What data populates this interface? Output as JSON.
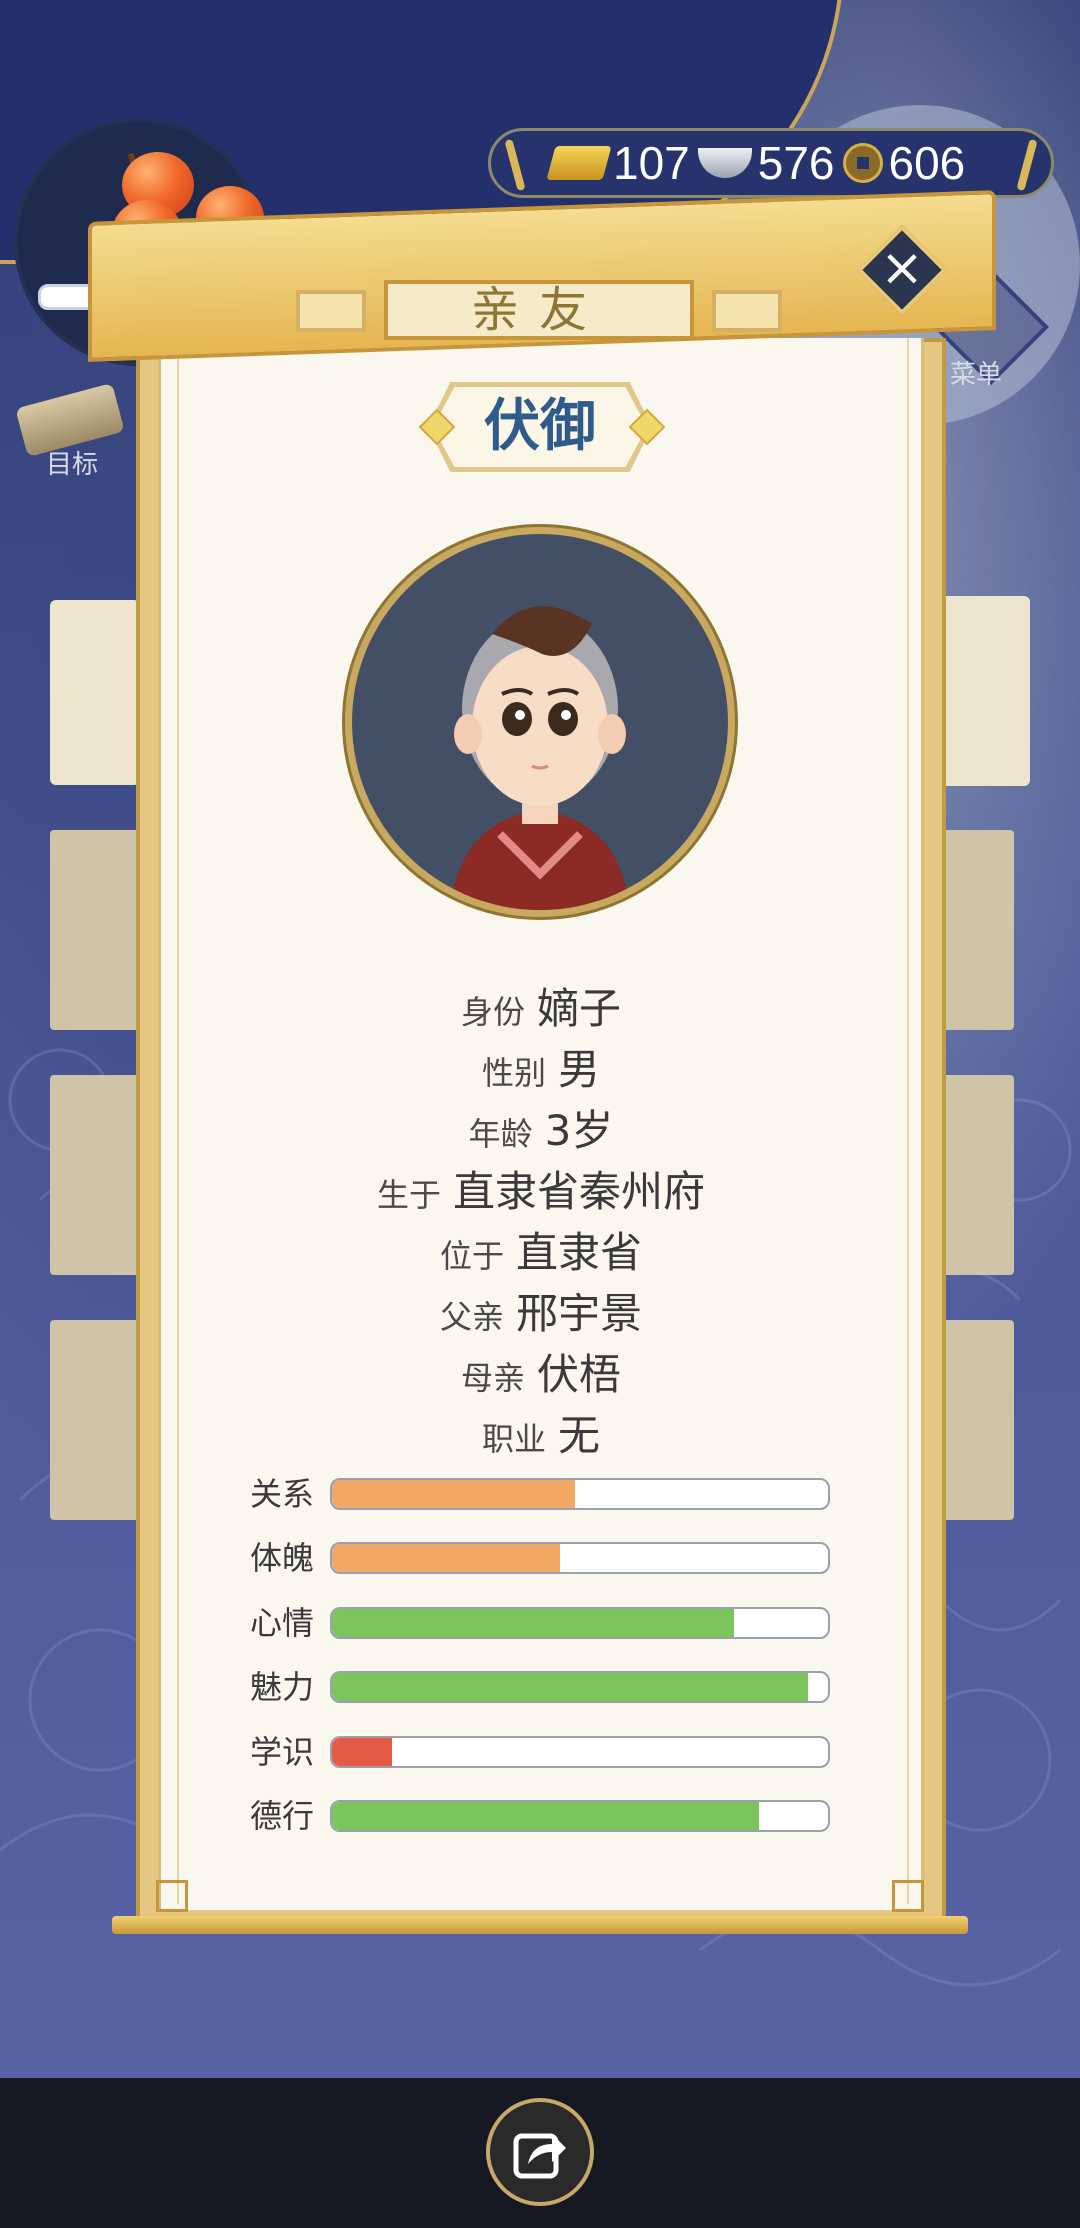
{
  "hud": {
    "currency": {
      "gold": "107",
      "silver": "576",
      "coin": "606"
    },
    "goal_label": "目标",
    "menu_label": "菜单"
  },
  "panel": {
    "tab_title": "亲友",
    "character_name": "伏御",
    "info": [
      {
        "label": "身份",
        "value": "嫡子"
      },
      {
        "label": "性别",
        "value": "男"
      },
      {
        "label": "年龄",
        "value": "3岁"
      },
      {
        "label": "生于",
        "value": "直隶省秦州府"
      },
      {
        "label": "位于",
        "value": "直隶省"
      },
      {
        "label": "父亲",
        "value": "邢宇景"
      },
      {
        "label": "母亲",
        "value": "伏梧"
      },
      {
        "label": "职业",
        "value": "无"
      }
    ],
    "stats": [
      {
        "label": "关系",
        "level": 0.49,
        "color": "#f0a862"
      },
      {
        "label": "体魄",
        "level": 0.46,
        "color": "#f0a862"
      },
      {
        "label": "心情",
        "level": 0.81,
        "color": "#7cc55a"
      },
      {
        "label": "魅力",
        "level": 0.96,
        "color": "#7cc55a"
      },
      {
        "label": "学识",
        "level": 0.12,
        "color": "#e45a43"
      },
      {
        "label": "德行",
        "level": 0.86,
        "color": "#7cc55a"
      }
    ]
  },
  "icons": {
    "close": "close-icon",
    "share": "share-icon",
    "gold": "gold-ingot-icon",
    "silver": "silver-ingot-icon",
    "coin": "copper-coin-icon"
  }
}
